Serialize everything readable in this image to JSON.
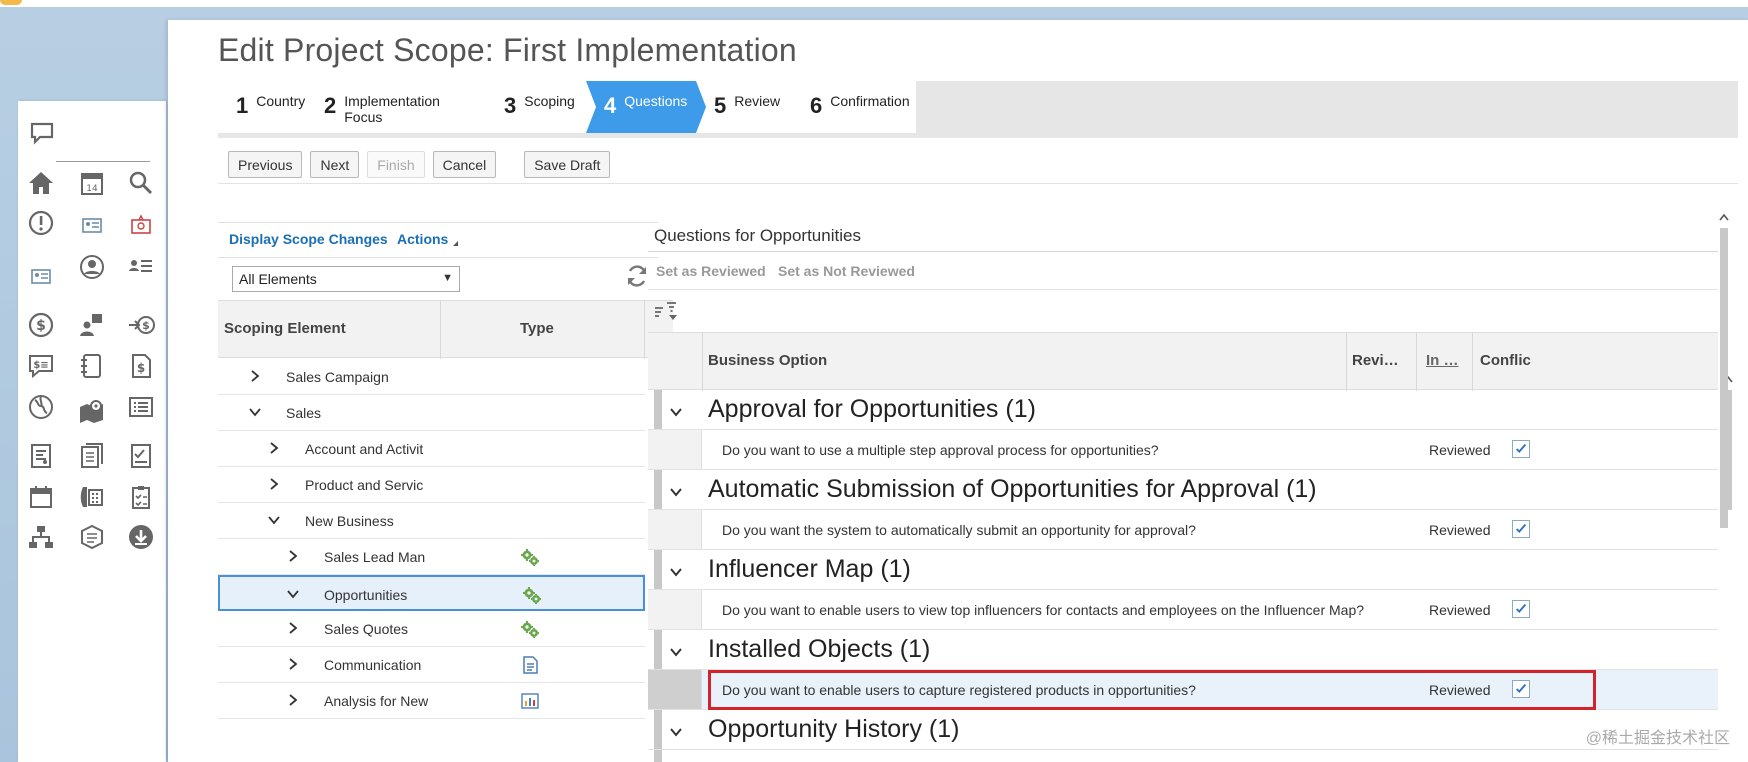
{
  "page": {
    "title": "Edit Project Scope: First Implementation"
  },
  "wizard": {
    "steps": [
      {
        "num": "1",
        "label": "Country"
      },
      {
        "num": "2",
        "label": "Implementation Focus"
      },
      {
        "num": "3",
        "label": "Scoping"
      },
      {
        "num": "4",
        "label": "Questions",
        "active": true
      },
      {
        "num": "5",
        "label": "Review"
      },
      {
        "num": "6",
        "label": "Confirmation"
      }
    ]
  },
  "toolbar": {
    "previous": "Previous",
    "next": "Next",
    "finish": "Finish",
    "cancel": "Cancel",
    "save_draft": "Save Draft"
  },
  "left": {
    "display_scope_changes": "Display Scope Changes",
    "actions": "Actions",
    "filter_value": "All Elements",
    "columns": {
      "scoping_element": "Scoping Element",
      "type": "Type"
    },
    "rows": [
      {
        "label": "Sales Campaign",
        "level": 1,
        "expanded": false
      },
      {
        "label": "Sales",
        "level": 1,
        "expanded": true
      },
      {
        "label": "Account and Activit",
        "level": 2,
        "expanded": false
      },
      {
        "label": "Product and Servic",
        "level": 2,
        "expanded": false
      },
      {
        "label": "New Business",
        "level": 2,
        "expanded": true
      },
      {
        "label": "Sales Lead Man",
        "level": 3,
        "expanded": false,
        "type_icon": "gears-icon"
      },
      {
        "label": "Opportunities",
        "level": 3,
        "expanded": true,
        "type_icon": "gears-icon",
        "selected": true
      },
      {
        "label": "Sales Quotes",
        "level": 3,
        "expanded": false,
        "type_icon": "gears-icon"
      },
      {
        "label": "Communication",
        "level": 3,
        "expanded": false,
        "type_icon": "document-icon"
      },
      {
        "label": "Analysis for New",
        "level": 3,
        "expanded": false,
        "type_icon": "chart-icon"
      }
    ]
  },
  "right": {
    "title": "Questions for Opportunities",
    "set_reviewed": "Set as Reviewed",
    "set_not_reviewed": "Set as Not Reviewed",
    "columns": {
      "business_option": "Business Option",
      "reviewed": "Revi…",
      "in_scope": "In …",
      "conflicts": "Conflic"
    },
    "groups": [
      {
        "title": "Approval for Opportunities (1)",
        "question": "Do you want to use a multiple step approval process for opportunities?",
        "status": "Reviewed",
        "checked": true
      },
      {
        "title": "Automatic Submission of Opportunities for Approval (1)",
        "question": "Do you want the system to automatically submit an opportunity for approval?",
        "status": "Reviewed",
        "checked": true
      },
      {
        "title": "Influencer Map (1)",
        "question": "Do you want to enable users to view top influencers for contacts and employees on the Influencer Map?",
        "status": "Reviewed",
        "checked": true
      },
      {
        "title": "Installed Objects (1)",
        "question": "Do you want to enable users to capture registered products in opportunities?",
        "status": "Reviewed",
        "checked": true,
        "highlighted": true
      },
      {
        "title": "Opportunity History (1)"
      }
    ]
  },
  "watermark": "@稀土掘金技术社区",
  "colors": {
    "accent": "#3d9be9",
    "link": "#1a6fb5",
    "highlight": "#d3232a"
  }
}
